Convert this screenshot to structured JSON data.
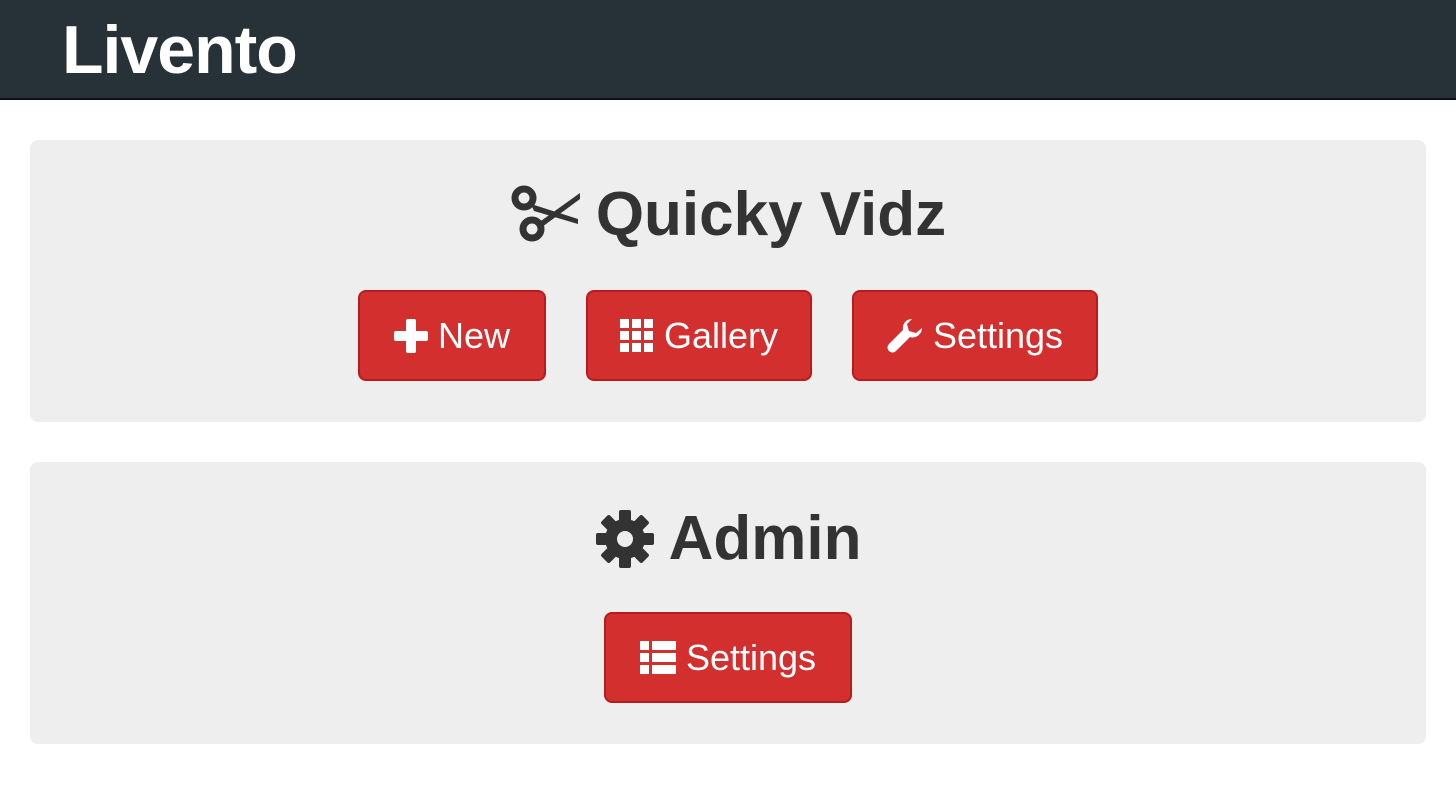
{
  "header": {
    "brand": "Livento"
  },
  "panels": {
    "quicky_vidz": {
      "title": "Quicky Vidz",
      "icon": "scissors-icon",
      "buttons": {
        "new": {
          "label": "New",
          "icon": "plus-icon"
        },
        "gallery": {
          "label": "Gallery",
          "icon": "grid-icon"
        },
        "settings": {
          "label": "Settings",
          "icon": "wrench-icon"
        }
      }
    },
    "admin": {
      "title": "Admin",
      "icon": "gear-icon",
      "buttons": {
        "settings": {
          "label": "Settings",
          "icon": "list-icon"
        }
      }
    }
  },
  "colors": {
    "navbar": "#263238",
    "panel": "#eeeeee",
    "button": "#d32f2f",
    "title_text": "#333333"
  }
}
